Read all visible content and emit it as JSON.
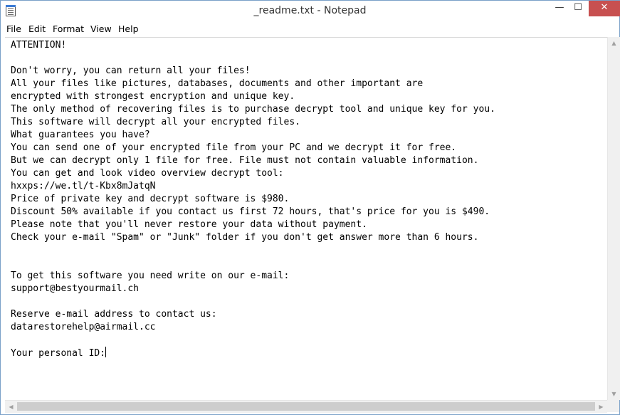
{
  "window": {
    "title": "_readme.txt - Notepad",
    "minimize_glyph": "—",
    "maximize_glyph": "☐",
    "close_glyph": "✕"
  },
  "menu": [
    "File",
    "Edit",
    "Format",
    "View",
    "Help"
  ],
  "editor": {
    "text": "ATTENTION!\n\nDon't worry, you can return all your files!\nAll your files like pictures, databases, documents and other important are\nencrypted with strongest encryption and unique key.\nThe only method of recovering files is to purchase decrypt tool and unique key for you.\nThis software will decrypt all your encrypted files.\nWhat guarantees you have?\nYou can send one of your encrypted file from your PC and we decrypt it for free.\nBut we can decrypt only 1 file for free. File must not contain valuable information.\nYou can get and look video overview decrypt tool:\nhxxps://we.tl/t-Kbx8mJatqN\nPrice of private key and decrypt software is $980.\nDiscount 50% available if you contact us first 72 hours, that's price for you is $490.\nPlease note that you'll never restore your data without payment.\nCheck your e-mail \"Spam\" or \"Junk\" folder if you don't get answer more than 6 hours.\n\n\nTo get this software you need write on our e-mail:\nsupport@bestyourmail.ch\n\nReserve e-mail address to contact us:\ndatarestorehelp@airmail.cc\n\nYour personal ID:"
  },
  "icons": {
    "app": "notepad-icon",
    "scroll_up": "▲",
    "scroll_down": "▼",
    "scroll_left": "◀",
    "scroll_right": "▶"
  }
}
